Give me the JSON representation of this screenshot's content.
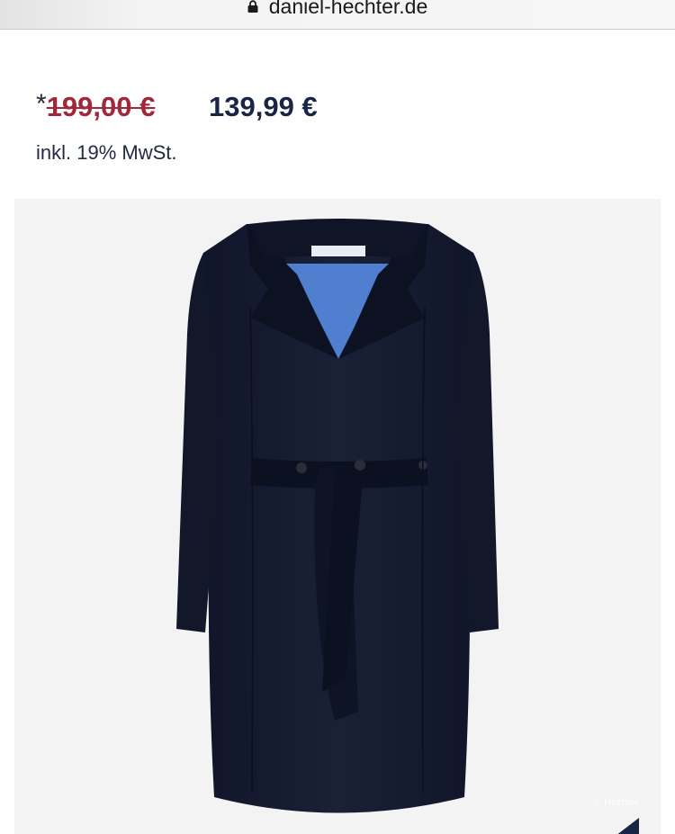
{
  "browser": {
    "url": "daniel-hechter.de",
    "lock_icon": "lock-icon"
  },
  "product": {
    "price_marker": "*",
    "old_price": "199,00 €",
    "new_price": "139,99 €",
    "tax_note": "inkl. 19% MwSt.",
    "image_watermark": "© Hechter"
  },
  "colors": {
    "old_price": "#a3273a",
    "new_price": "#1a2546",
    "coat": "#151a2c",
    "lining": "#4f7fce",
    "image_background": "#f3f3f3"
  }
}
